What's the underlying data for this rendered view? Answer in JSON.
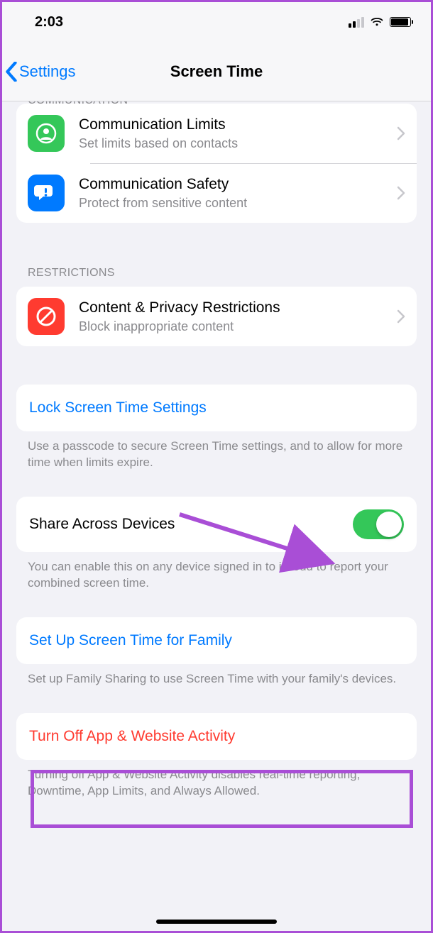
{
  "status": {
    "time": "2:03"
  },
  "nav": {
    "back_label": "Settings",
    "title": "Screen Time"
  },
  "sections": {
    "communication_header": "COMMUNICATION",
    "restrictions_header": "RESTRICTIONS"
  },
  "rows": {
    "comm_limits": {
      "title": "Communication Limits",
      "sub": "Set limits based on contacts"
    },
    "comm_safety": {
      "title": "Communication Safety",
      "sub": "Protect from sensitive content"
    },
    "content_privacy": {
      "title": "Content & Privacy Restrictions",
      "sub": "Block inappropriate content"
    },
    "lock": {
      "title": "Lock Screen Time Settings"
    },
    "share": {
      "title": "Share Across Devices",
      "on": true
    },
    "family": {
      "title": "Set Up Screen Time for Family"
    },
    "turn_off": {
      "title": "Turn Off App & Website Activity"
    }
  },
  "footers": {
    "lock": "Use a passcode to secure Screen Time settings, and to allow for more time when limits expire.",
    "share": "You can enable this on any device signed in to iCloud to report your combined screen time.",
    "family": "Set up Family Sharing to use Screen Time with your family's devices.",
    "turn_off": "Turning off App & Website Activity disables real-time reporting, Downtime, App Limits, and Always Allowed."
  },
  "colors": {
    "link": "#007aff",
    "destructive": "#ff3b30",
    "toggle_on": "#34c759",
    "annotation": "#a94ed6"
  }
}
